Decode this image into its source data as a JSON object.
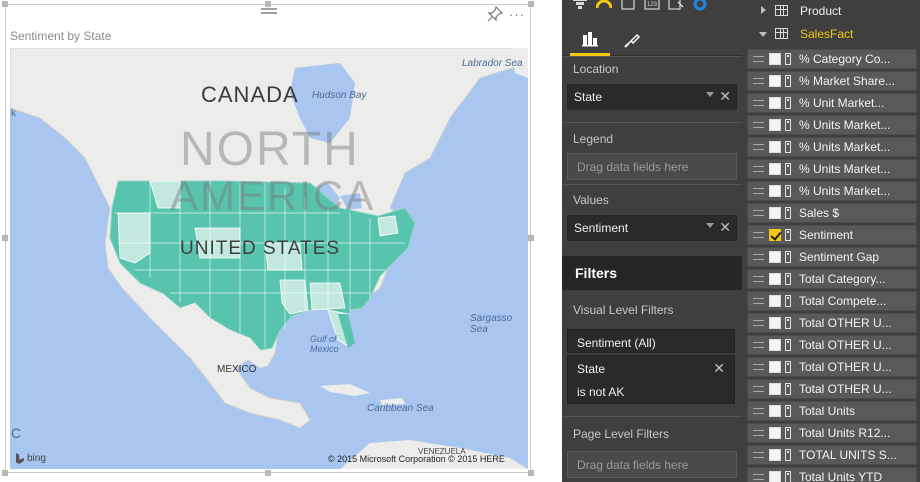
{
  "visual": {
    "title": "Sentiment by State",
    "more_label": "···",
    "map_labels": {
      "canada": "CANADA",
      "north": "NORTH",
      "america": "AMERICA",
      "united_states": "UNITED STATES",
      "hudson_bay": "Hudson Bay",
      "labrador_sea": "Labrador Sea",
      "sargasso_sea": "Sargasso Sea",
      "gulf_of_mexico": "Gulf of Mexico",
      "mexico": "MEXICO",
      "caribbean_sea": "Caribbean Sea",
      "venezuela": "VENEZUELA",
      "edge_c": "C",
      "edge_k": "k"
    },
    "bing_label": "bing",
    "copyright": "© 2015 Microsoft Corporation    © 2015 HERE",
    "colors": {
      "ocean": "#a8c6ef",
      "land": "#ececea",
      "filled_state": "#59c4ad",
      "light_state": "#c2e8df"
    }
  },
  "viz_pane": {
    "tabs": [
      {
        "name": "fields",
        "icon": "bar-chart-icon"
      },
      {
        "name": "format",
        "icon": "paint-roller-icon"
      }
    ],
    "location": {
      "header": "Location",
      "value": "State"
    },
    "legend": {
      "header": "Legend",
      "placeholder": "Drag data fields here"
    },
    "values": {
      "header": "Values",
      "value": "Sentiment"
    },
    "filters": {
      "title": "Filters",
      "visual_level_header": "Visual Level Filters",
      "visual_filters": [
        {
          "label": "Sentiment (All)"
        },
        {
          "label": "State",
          "condition": "is not AK"
        }
      ],
      "page_level_header": "Page Level Filters",
      "page_placeholder": "Drag data fields here"
    },
    "accent_color": "#f2c811"
  },
  "fields_pane": {
    "tables": [
      {
        "name": "Product",
        "expanded": false
      },
      {
        "name": "SalesFact",
        "expanded": true
      }
    ],
    "fields": [
      {
        "label": "% Category Co...",
        "checked": false
      },
      {
        "label": "% Market Share...",
        "checked": false
      },
      {
        "label": "% Unit Market...",
        "checked": false
      },
      {
        "label": "% Units Market...",
        "checked": false
      },
      {
        "label": "% Units Market...",
        "checked": false
      },
      {
        "label": "% Units Market...",
        "checked": false
      },
      {
        "label": "% Units Market...",
        "checked": false
      },
      {
        "label": "Sales $",
        "checked": false
      },
      {
        "label": "Sentiment",
        "checked": true
      },
      {
        "label": "Sentiment Gap",
        "checked": false
      },
      {
        "label": "Total Category...",
        "checked": false
      },
      {
        "label": "Total Compete...",
        "checked": false
      },
      {
        "label": "Total OTHER U...",
        "checked": false
      },
      {
        "label": "Total OTHER U...",
        "checked": false
      },
      {
        "label": "Total OTHER U...",
        "checked": false
      },
      {
        "label": "Total OTHER U...",
        "checked": false
      },
      {
        "label": "Total Units",
        "checked": false
      },
      {
        "label": "Total Units R12...",
        "checked": false
      },
      {
        "label": "TOTAL UNITS S...",
        "checked": false
      },
      {
        "label": "Total Units YTD",
        "checked": false
      }
    ]
  }
}
